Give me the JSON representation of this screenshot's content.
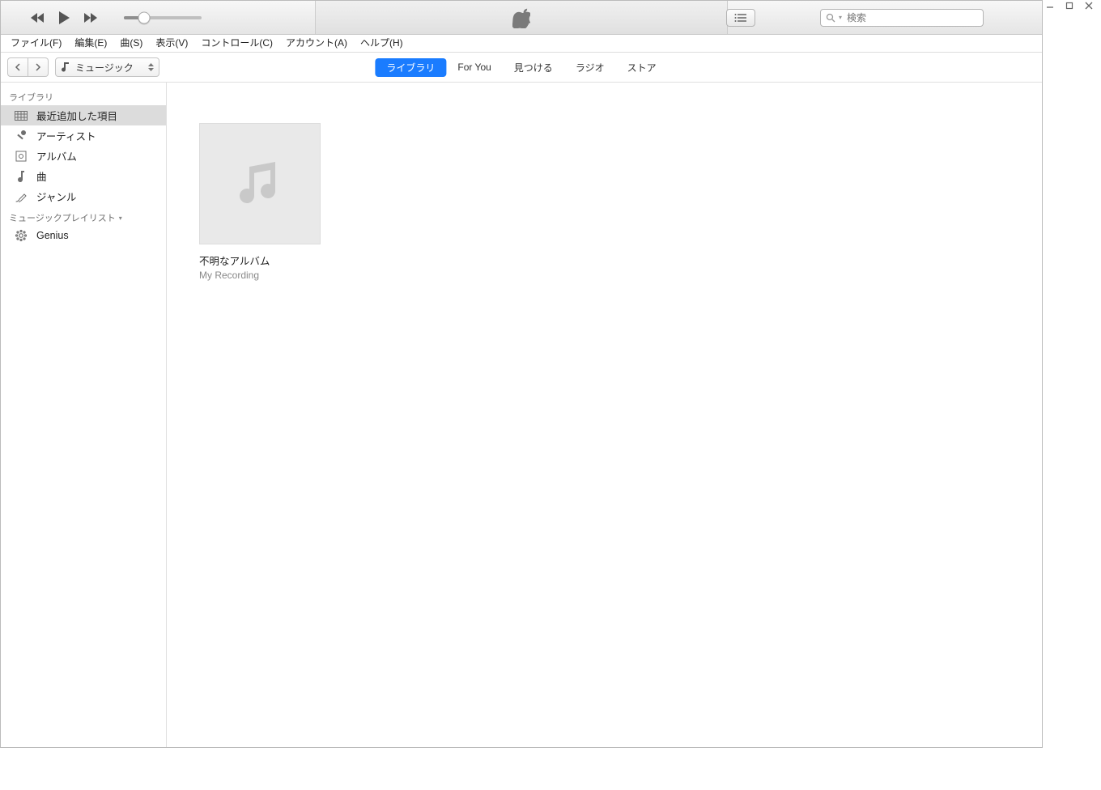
{
  "menu": {
    "items": [
      "ファイル(F)",
      "編集(E)",
      "曲(S)",
      "表示(V)",
      "コントロール(C)",
      "アカウント(A)",
      "ヘルプ(H)"
    ]
  },
  "media_picker": {
    "label": "ミュージック"
  },
  "tabs": {
    "items": [
      "ライブラリ",
      "For You",
      "見つける",
      "ラジオ",
      "ストア"
    ],
    "active": 0
  },
  "search": {
    "placeholder": "検索"
  },
  "sidebar": {
    "library_header": "ライブラリ",
    "library_items": [
      "最近追加した項目",
      "アーティスト",
      "アルバム",
      "曲",
      "ジャンル"
    ],
    "playlists_header": "ミュージックプレイリスト",
    "playlists": [
      "Genius"
    ]
  },
  "albums": [
    {
      "title": "不明なアルバム",
      "subtitle": "My Recording"
    }
  ]
}
